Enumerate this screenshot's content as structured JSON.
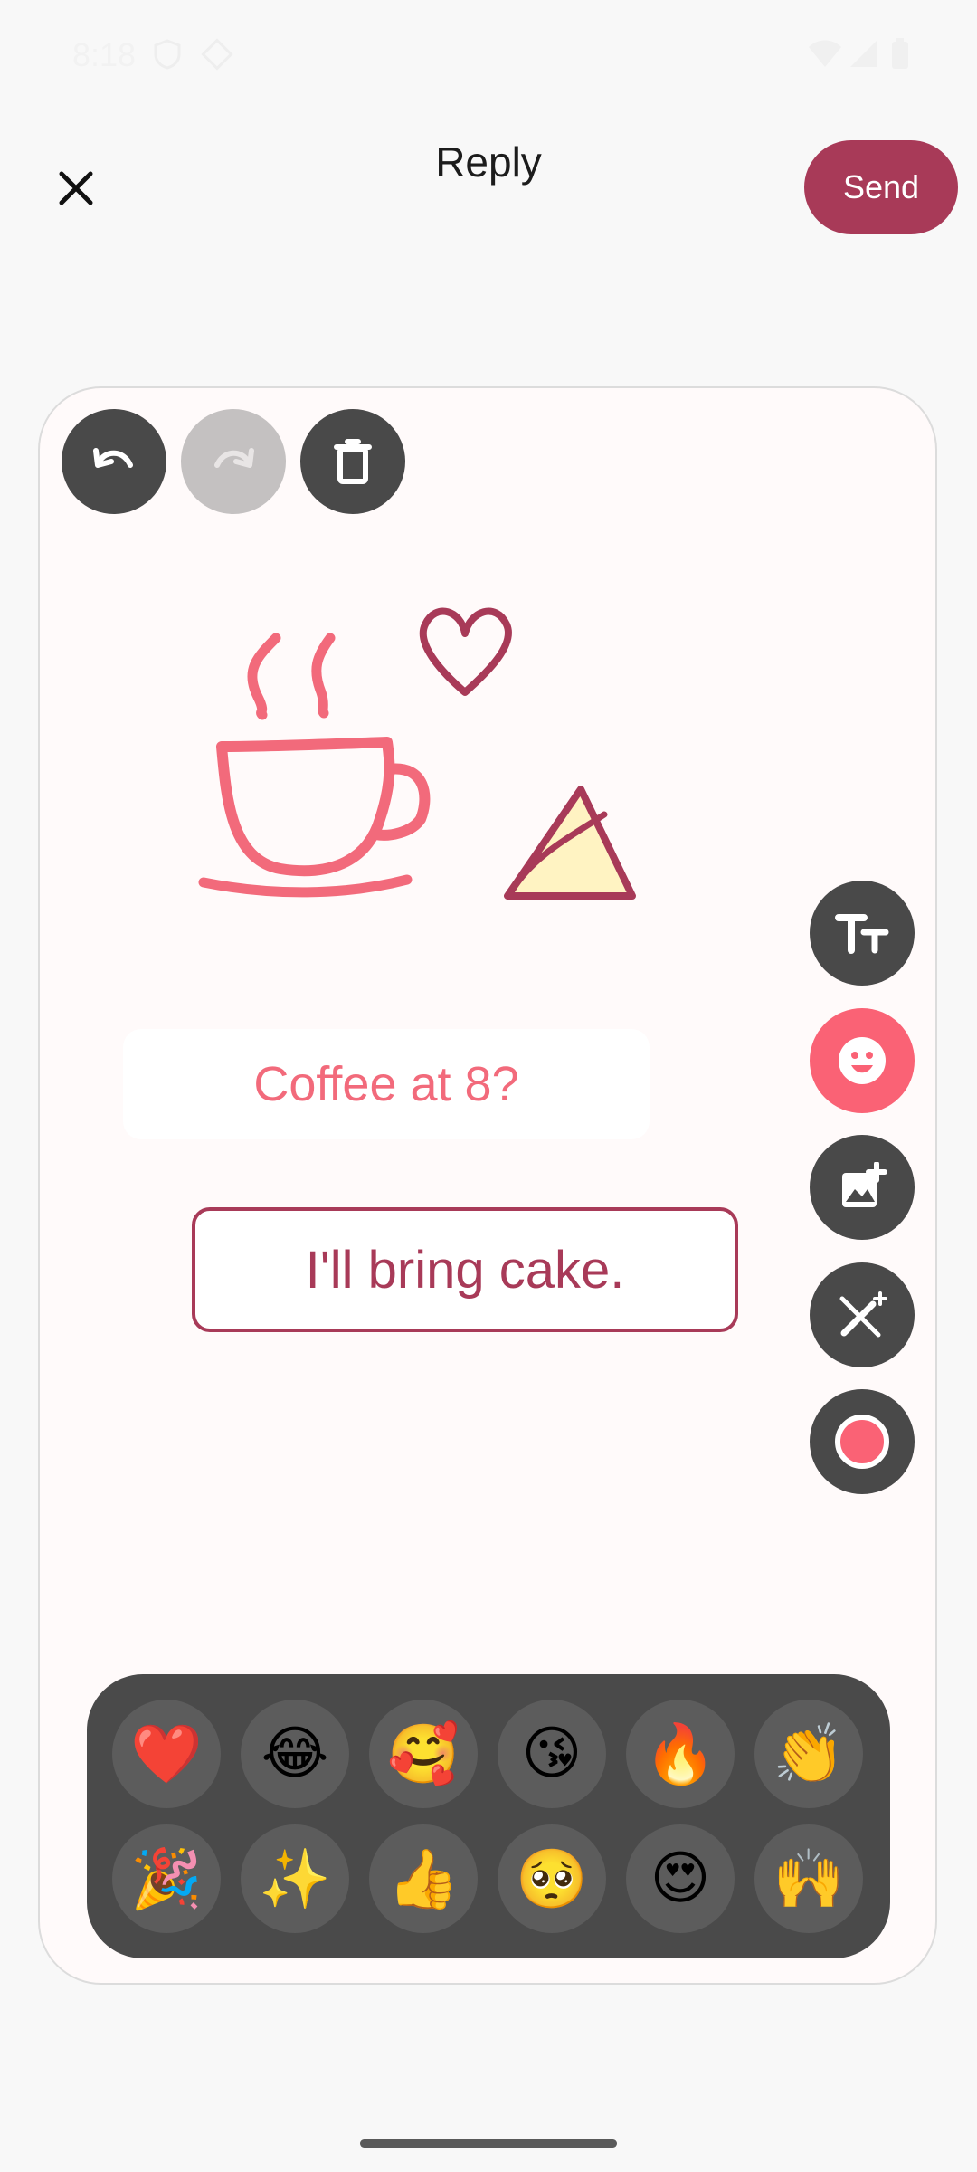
{
  "status": {
    "time": "8:18"
  },
  "header": {
    "title": "Reply",
    "send_label": "Send"
  },
  "canvas": {
    "text_sticker_1": "Coffee at 8?",
    "text_sticker_2": "I'll bring cake."
  },
  "toolbar_top": [
    "undo-icon",
    "redo-icon",
    "delete-icon"
  ],
  "tools_side": [
    "text-icon",
    "emoji-icon",
    "add-image-icon",
    "magic-wand-icon",
    "record-icon"
  ],
  "emoji_picker": {
    "row1": [
      "❤️",
      "😂",
      "🥰",
      "😘",
      "🔥",
      "👏"
    ],
    "row2": [
      "🎉",
      "✨",
      "👍",
      "🥺",
      "😍",
      "🙌"
    ]
  },
  "colors": {
    "accent": "#a83a58",
    "pink": "#fa6275",
    "tool_dark": "#494949"
  }
}
